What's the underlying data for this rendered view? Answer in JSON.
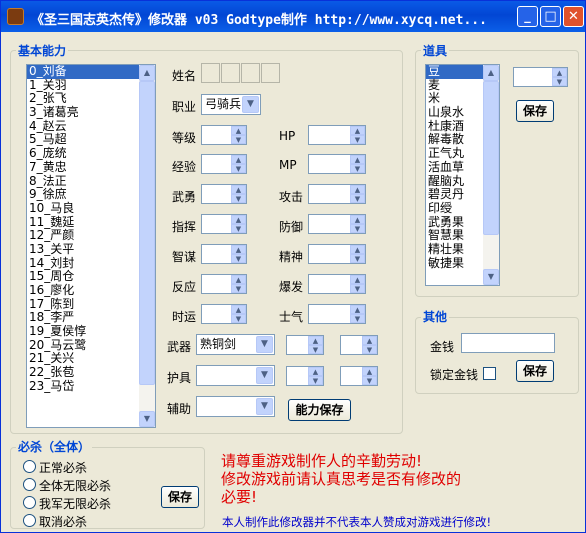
{
  "window": {
    "title": "《圣三国志英杰传》修改器 v03  Godtype制作 http://www.xycq.net...",
    "buttons": {
      "minimize": "_",
      "maximize": "□",
      "close": "✕"
    }
  },
  "basic": {
    "group_title": "基本能力",
    "characters": [
      "0_刘备",
      "1_关羽",
      "2_张飞",
      "3_诸葛亮",
      "4_赵云",
      "5_马超",
      "6_庞统",
      "7_黄忠",
      "8_法正",
      "9_徐庶",
      "10_马良",
      "11_魏延",
      "12_严颜",
      "13_关平",
      "14_刘封",
      "15_周仓",
      "16_廖化",
      "17_陈到",
      "18_李严",
      "19_夏侯惇",
      "20_马云鹭",
      "21_关兴",
      "22_张苞",
      "23_马岱"
    ],
    "selected_character": "0_刘备",
    "name_label": "姓名",
    "job_label": "职业",
    "job_value": "弓骑兵",
    "left_fields": [
      "等级",
      "经验",
      "武勇",
      "指挥",
      "智谋",
      "反应",
      "时运"
    ],
    "right_fields": [
      "HP",
      "MP",
      "攻击",
      "防御",
      "精神",
      "爆发",
      "士气"
    ],
    "equip": [
      {
        "label": "武器",
        "value": "熟铜剑"
      },
      {
        "label": "护具",
        "value": ""
      },
      {
        "label": "辅助",
        "value": ""
      }
    ],
    "save_label": "能力保存"
  },
  "items": {
    "group_title": "道具",
    "list": [
      "豆",
      "麦",
      "米",
      "山泉水",
      "杜康酒",
      "解毒散",
      "正气丸",
      "活血草",
      "醒脑丸",
      "碧灵丹",
      "印绶",
      "武勇果",
      "智慧果",
      "精壮果",
      "敏捷果"
    ],
    "selected_item": "豆",
    "save_label": "保存"
  },
  "other": {
    "group_title": "其他",
    "money_label": "金钱",
    "money_value": "",
    "lock_label": "锁定金钱",
    "save_label": "保存"
  },
  "kill": {
    "group_title": "必杀（全体）",
    "options": [
      "正常必杀",
      "全体无限必杀",
      "我军无限必杀",
      "取消必杀"
    ],
    "save_label": "保存"
  },
  "notice": {
    "line1": "请尊重游戏制作人的辛勤劳动!",
    "line2": "修改游戏前请认真思考是否有修改的",
    "line3": "必要!",
    "disclaimer": "本人制作此修改器并不代表本人赞成对游戏进行修改!"
  }
}
